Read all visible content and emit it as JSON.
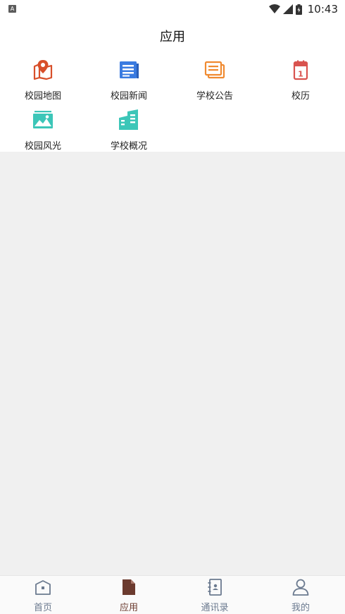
{
  "status_bar": {
    "time": "10:43",
    "app_icon_letter": "A"
  },
  "header": {
    "title": "应用"
  },
  "apps": [
    {
      "label": "校园地图",
      "icon": "map-pin-icon",
      "color": "#d84f2a"
    },
    {
      "label": "校园新闻",
      "icon": "news-icon",
      "color": "#3a7be0"
    },
    {
      "label": "学校公告",
      "icon": "notice-icon",
      "color": "#f08a30"
    },
    {
      "label": "校历",
      "icon": "calendar-icon",
      "color": "#d9534f",
      "badge": "1"
    },
    {
      "label": "校园风光",
      "icon": "landscape-icon",
      "color": "#3cc6b8"
    },
    {
      "label": "学校概况",
      "icon": "building-icon",
      "color": "#3cc6b8"
    }
  ],
  "tabs": [
    {
      "label": "首页",
      "icon": "home-icon",
      "active": false
    },
    {
      "label": "应用",
      "icon": "app-document-icon",
      "active": true
    },
    {
      "label": "通讯录",
      "icon": "contacts-icon",
      "active": false
    },
    {
      "label": "我的",
      "icon": "profile-icon",
      "active": false
    }
  ],
  "colors": {
    "tab_active": "#6b3a2e",
    "tab_inactive": "#6b7a8f",
    "content_bg": "#f0f0f0"
  }
}
